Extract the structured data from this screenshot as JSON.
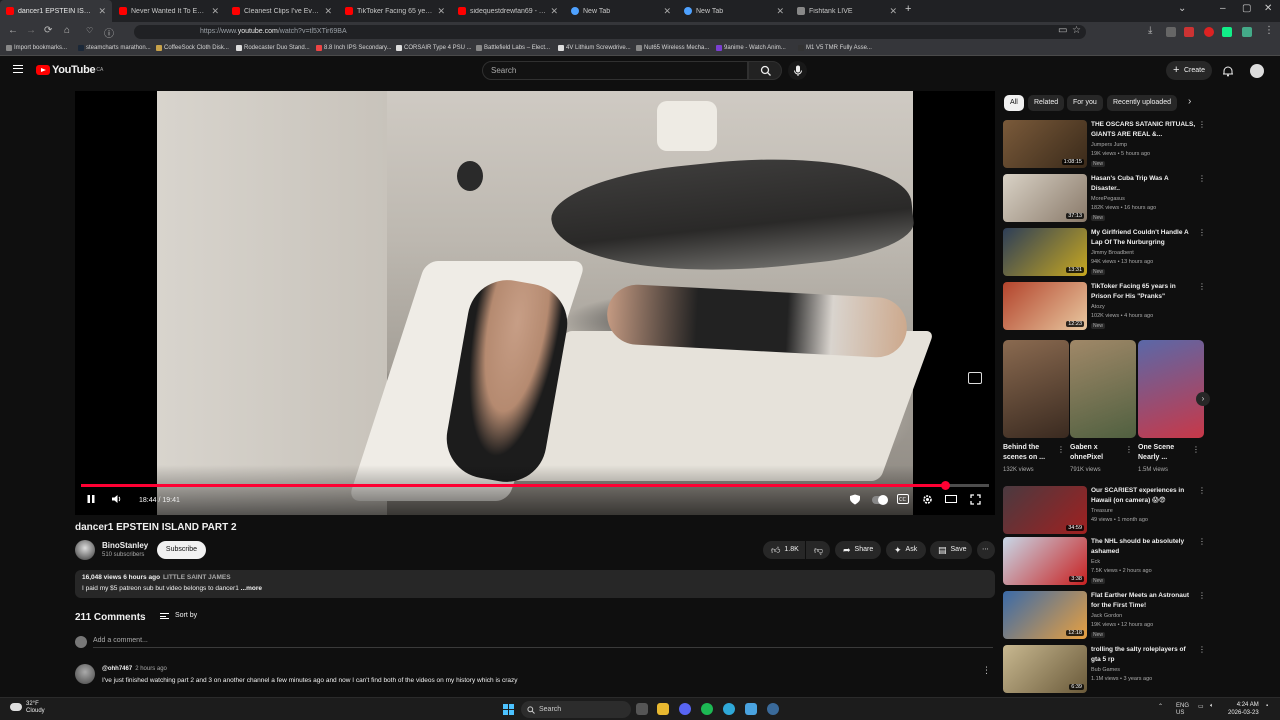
{
  "browser": {
    "tabs": [
      {
        "title": "dancer1 EPSTEIN ISLAND PART",
        "sub": "PLAYING",
        "active": true,
        "color": "#ff0000"
      },
      {
        "title": "Never Wanted It To End - YouT",
        "active": false,
        "color": "#ff0000"
      },
      {
        "title": "Cleanest Clips I've Ever Hit... (Al",
        "active": false,
        "color": "#ff0000"
      },
      {
        "title": "TikToker Facing 65 years in Pris",
        "active": false,
        "color": "#ff0000"
      },
      {
        "title": "sidequestdrewfan69 - YouTube",
        "active": false,
        "color": "#ff0000"
      },
      {
        "title": "New Tab",
        "active": false,
        "color": "#4ea1ff"
      },
      {
        "title": "New Tab",
        "active": false,
        "color": "#4ea1ff"
      },
      {
        "title": "Fishtank LIVE",
        "sub": "MUTED",
        "active": false,
        "color": "#888888"
      }
    ],
    "url_prefix": "https://www.",
    "url_host": "youtube.com",
    "url_rest": "/watch?v=tl5XTir69BA",
    "bookmarks": [
      {
        "label": "Import bookmarks...",
        "color": "#888"
      },
      {
        "label": "steamcharts marathon...",
        "color": "#1b2838"
      },
      {
        "label": "CoffeeSock Cloth Disk...",
        "color": "#c8a24a"
      },
      {
        "label": "Rodecaster Duo Stand...",
        "color": "#ddd"
      },
      {
        "label": "8.8 Inch IPS Secondary...",
        "color": "#e44"
      },
      {
        "label": "CORSAIR Type 4 PSU ...",
        "color": "#ddd"
      },
      {
        "label": "Battlefield Labs – Elect...",
        "color": "#888"
      },
      {
        "label": "4V Lithium Screwdrive...",
        "color": "#ddd"
      },
      {
        "label": "Nut65 Wireless Mecha...",
        "color": "#888"
      },
      {
        "label": "9anime - Watch Anim...",
        "color": "#7a3fd1"
      },
      {
        "label": "M1 V5 TMR Fully Asse...",
        "color": "#333"
      }
    ]
  },
  "youtube": {
    "logo": "YouTube",
    "region": "CA",
    "search_placeholder": "Search",
    "create_label": "Create"
  },
  "player": {
    "current_time": "18:44",
    "duration": "19:41",
    "progress": 0.952
  },
  "video": {
    "title": "dancer1 EPSTEIN ISLAND PART 2",
    "channel": "BinoStanley",
    "subscribers": "510 subscribers",
    "subscribe_label": "Subscribe",
    "likes": "1.8K",
    "share_label": "Share",
    "ask_label": "Ask",
    "save_label": "Save",
    "views_time": "16,048 views  6 hours ago",
    "tag": "LITTLE SAINT JAMES",
    "description": "I paid my $5 patreon sub but video belongs to dancer1",
    "more_label": "...more"
  },
  "comments": {
    "count_label": "211 Comments",
    "sort_label": "Sort by",
    "add_placeholder": "Add a comment...",
    "items": [
      {
        "author": "@ohh7467",
        "time": "2 hours ago",
        "text": "I've just finished watching part 2 and 3 on another channel a few minutes ago and now I can't find both of the videos on my history which is crazy"
      }
    ]
  },
  "sidebar": {
    "chips": [
      "All",
      "Related",
      "For you",
      "Recently uploaded"
    ],
    "recs": [
      {
        "title": "THE OSCARS SATANIC RITUALS, GIANTS ARE REAL &...",
        "channel": "Jumpers Jump",
        "meta": "19K views • 5 hours ago",
        "new": "New",
        "duration": "1:08:15",
        "thumb": "#7a5a3a"
      },
      {
        "title": "Hasan's Cuba Trip Was A Disaster..",
        "channel": "MorePegasus",
        "meta": "182K views • 16 hours ago",
        "new": "New",
        "duration": "37:13",
        "thumb": "#d9d2c6"
      },
      {
        "title": "My Girlfriend Couldn't Handle A Lap Of The Nurburgring",
        "channel": "Jimmy Broadbent",
        "meta": "94K views • 13 hours ago",
        "new": "New",
        "duration": "13:31",
        "thumb": "#2d3e58"
      },
      {
        "title": "TikToker Facing 65 years in Prison For His \"Pranks\"",
        "channel": "Atozy",
        "meta": "102K views • 4 hours ago",
        "new": "New",
        "duration": "12:23",
        "thumb": "#b3442c"
      }
    ],
    "shorts": [
      {
        "title": "Behind the scenes on ...",
        "views": "132K views",
        "thumb": "#8a6a50"
      },
      {
        "title": "Gaben x ohnePixel",
        "views": "791K views",
        "thumb": "#a08868"
      },
      {
        "title": "One Scene Nearly ...",
        "views": "1.5M views",
        "thumb": "#5a68a8"
      }
    ],
    "recs2": [
      {
        "title": "Our SCARIEST experiences in Hawaii (on camera) 😱😨",
        "channel": "Treasure",
        "meta": "49 views • 1 month ago",
        "new": "",
        "duration": "34:59",
        "thumb": "#4a3a40"
      },
      {
        "title": "The NHL should be absolutely ashamed",
        "channel": "Eck",
        "meta": "7.5K views • 2 hours ago",
        "new": "New",
        "duration": "3:38",
        "thumb": "#c8d8e8"
      },
      {
        "title": "Flat Earther Meets an Astronaut for the First Time!",
        "channel": "Jack Gordon",
        "meta": "19K views • 12 hours ago",
        "new": "New",
        "duration": "12:18",
        "thumb": "#3a6aa8"
      },
      {
        "title": "trolling the salty roleplayers of gta 5 rp",
        "channel": "Bub Games",
        "meta": "1.1M views • 3 years ago",
        "new": "",
        "duration": "6:39",
        "thumb": "#c8b890"
      }
    ]
  },
  "taskbar": {
    "temp": "32°F",
    "weather": "Cloudy",
    "search_label": "Search",
    "lang1": "ENG",
    "lang2": "US",
    "time": "4:24 AM",
    "date": "2026-03-23"
  },
  "colors": {
    "accent": "#ff0033",
    "background": "#0f0f0f",
    "surface": "#272727"
  }
}
